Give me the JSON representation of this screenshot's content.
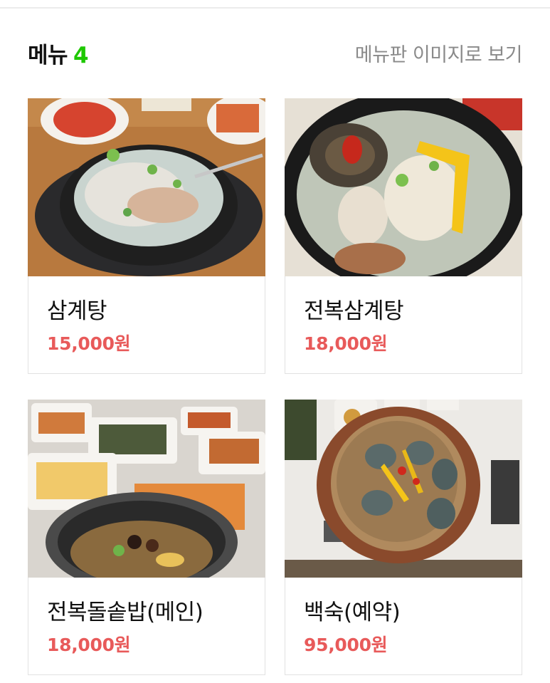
{
  "header": {
    "title": "메뉴",
    "count": "4",
    "view_menu_board": "메뉴판 이미지로 보기"
  },
  "menu": [
    {
      "name": "삼계탕",
      "price": "15,000원",
      "image": "samgyetang-photo"
    },
    {
      "name": "전복삼계탕",
      "price": "18,000원",
      "image": "abalone-samgyetang-photo"
    },
    {
      "name": "전복돌솥밥(메인)",
      "price": "18,000원",
      "image": "abalone-stone-pot-rice-photo"
    },
    {
      "name": "백숙(예약)",
      "price": "95,000원",
      "image": "baeksuk-photo"
    }
  ],
  "colors": {
    "accent_green": "#1ec800",
    "price_red": "#e85a5a",
    "title": "#111111",
    "link_gray": "#8a8a8a"
  }
}
